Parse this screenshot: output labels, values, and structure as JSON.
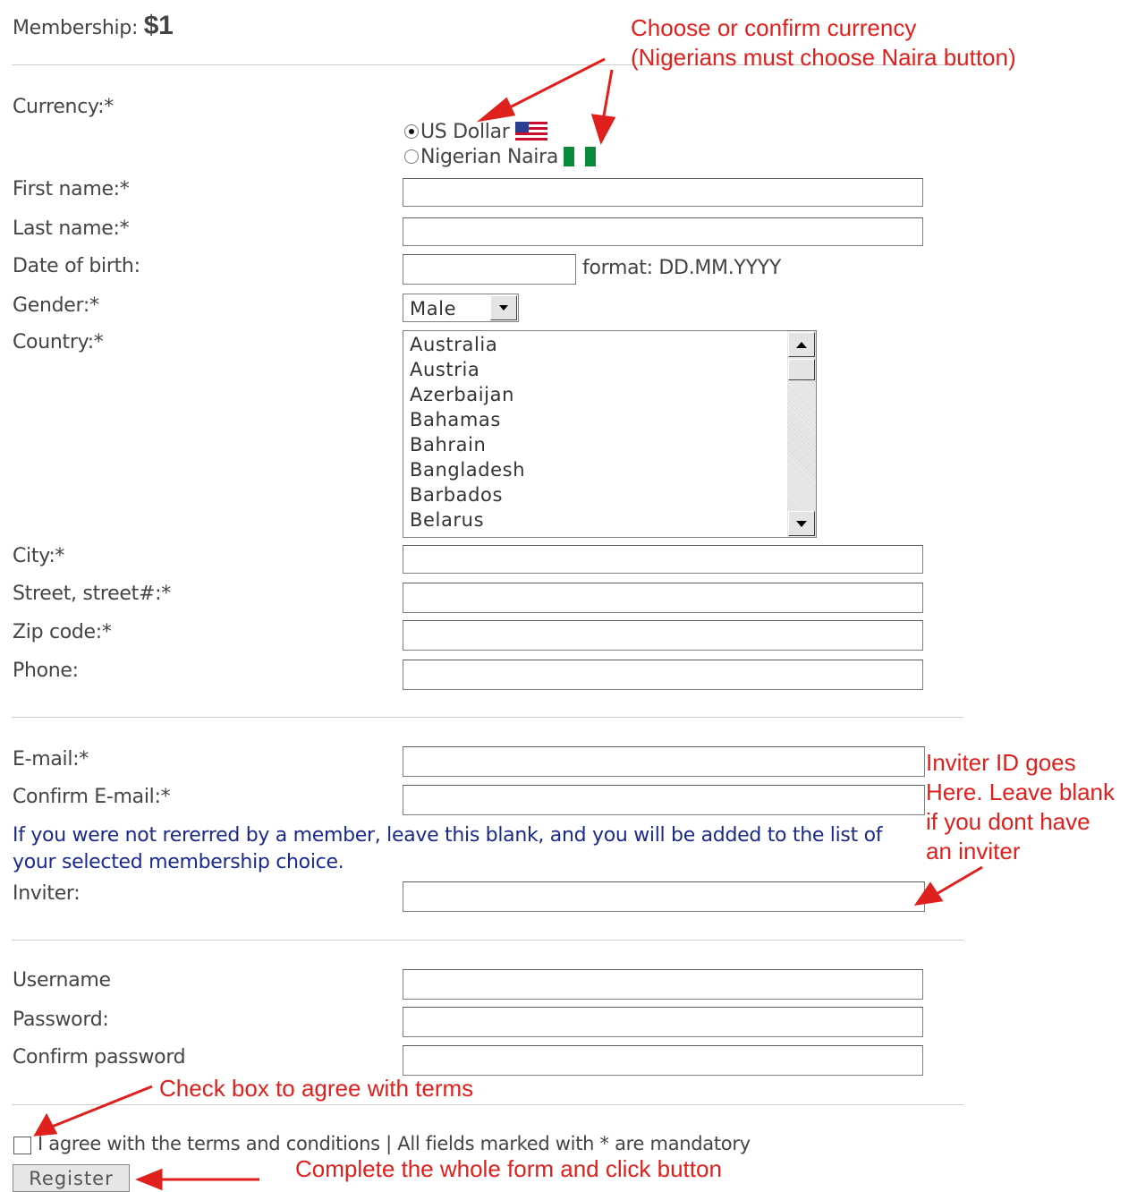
{
  "membership": {
    "label": "Membership:",
    "price": "$1"
  },
  "currency": {
    "label": "Currency:*",
    "options": [
      {
        "label": "US Dollar",
        "selected": true,
        "flag": "us-flag-icon"
      },
      {
        "label": "Nigerian Naira",
        "selected": false,
        "flag": "nigeria-flag-icon"
      }
    ]
  },
  "fields": {
    "first_name": "First name:*",
    "last_name": "Last name:*",
    "dob": "Date of birth:",
    "dob_format": "format: DD.MM.YYYY",
    "gender": "Gender:*",
    "gender_value": "Male",
    "country": "Country:*",
    "countries": [
      "Australia",
      "Austria",
      "Azerbaijan",
      "Bahamas",
      "Bahrain",
      "Bangladesh",
      "Barbados",
      "Belarus"
    ],
    "city": "City:*",
    "street": "Street, street#:*",
    "zip": "Zip code:*",
    "phone": "Phone:",
    "email": "E-mail:*",
    "confirm_email": "Confirm E-mail:*",
    "referral_note": "If you were not rererred by a member, leave this blank, and you will be added to the list of your selected membership choice.",
    "inviter": "Inviter:",
    "username": "Username",
    "password": "Password:",
    "confirm_password": "Confirm password"
  },
  "terms": "I agree with the terms and conditions | All fields marked with * are mandatory",
  "register_label": "Register",
  "annotations": {
    "currency_line1": "Choose or confirm currency",
    "currency_line2": "(Nigerians must choose Naira button)",
    "inviter_line1": "Inviter ID goes",
    "inviter_line2": "Here. Leave blank",
    "inviter_line3": "if you dont have",
    "inviter_line4": "an inviter",
    "terms_note": "Check box to agree with terms",
    "register_note": "Complete the whole form and click button"
  },
  "colors": {
    "annotation": "#e0201c",
    "note": "#1a2a8c"
  }
}
